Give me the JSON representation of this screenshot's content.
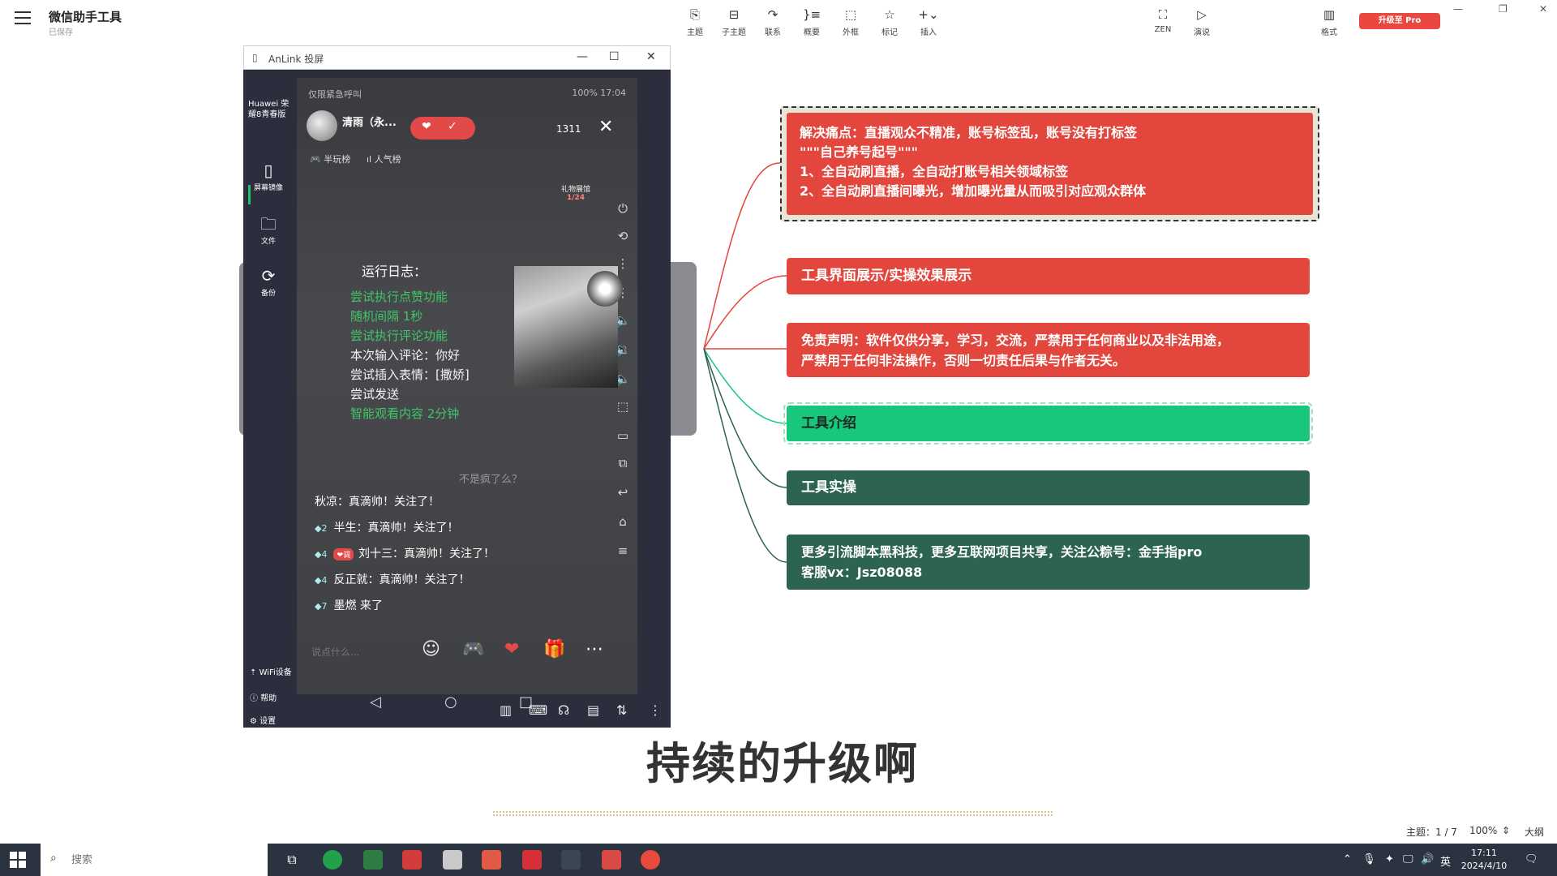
{
  "app": {
    "title": "微信助手工具",
    "subtitle": "已保存",
    "upgrade_label": "升级至 Pro"
  },
  "toolbar": [
    {
      "icon": "topic-icon",
      "glyph": "⎘",
      "label": "主题"
    },
    {
      "icon": "subtopic-icon",
      "glyph": "⊟",
      "label": "子主题"
    },
    {
      "icon": "relation-icon",
      "glyph": "↷",
      "label": "联系"
    },
    {
      "icon": "summary-icon",
      "glyph": "}≡",
      "label": "概要"
    },
    {
      "icon": "boundary-icon",
      "glyph": "⬚",
      "label": "外框"
    },
    {
      "icon": "marker-icon",
      "glyph": "☆",
      "label": "标记"
    },
    {
      "icon": "insert-icon",
      "glyph": "+⌄",
      "label": "插入"
    },
    {
      "icon": "zen-icon",
      "glyph": "⛶",
      "label": "ZEN"
    },
    {
      "icon": "present-icon",
      "glyph": "▷",
      "label": "演说"
    },
    {
      "icon": "format-icon",
      "glyph": "▥",
      "label": "格式"
    }
  ],
  "mirror": {
    "window_title": "AnLink 投屏",
    "device": "Huawei 荣耀8青春版",
    "sidebar": [
      {
        "icon": "phone-icon",
        "glyph": "▯",
        "label": "屏幕镜像"
      },
      {
        "icon": "folder-icon",
        "glyph": "🗀",
        "label": "文件"
      },
      {
        "icon": "backup-icon",
        "glyph": "⟳",
        "label": "备份"
      }
    ],
    "bottom": {
      "wifi": "WiFi设备",
      "help": "帮助",
      "settings": "设置"
    },
    "phone": {
      "status_left": "仅限紧急呼叫",
      "status_right": "100% 17:04",
      "streamer_name": "清雨（永...",
      "viewers": "1311",
      "rank_left": "半玩榜",
      "rank_right": "人气榜",
      "gift_title": "礼物展馆",
      "gift_count": "1/24",
      "log_title": "运行日志：",
      "log_lines": [
        {
          "text": "尝试执行点赞功能",
          "color": "green"
        },
        {
          "text": "随机间隔 1秒",
          "color": "green"
        },
        {
          "text": "尝试执行评论功能",
          "color": "green"
        },
        {
          "text": "本次输入评论：你好",
          "color": "white"
        },
        {
          "text": "尝试插入表情：[撒娇]",
          "color": "white"
        },
        {
          "text": "尝试发送",
          "color": "white"
        },
        {
          "text": "智能观看内容 2分钟",
          "color": "green"
        }
      ],
      "faded_comment": "不是疯了么？",
      "chat": [
        {
          "level": "",
          "badge": "",
          "text": "秋凉：真滴帅！关注了！"
        },
        {
          "level": "◆2",
          "badge": "",
          "text": "半生：真滴帅！关注了！"
        },
        {
          "level": "◆4",
          "badge": "❤调",
          "text": "刘十三：真滴帅！关注了！"
        },
        {
          "level": "◆4",
          "badge": "",
          "text": "反正就：真滴帅！关注了！"
        },
        {
          "level": "◆7",
          "badge": "",
          "text": "墨燃 来了"
        }
      ],
      "say_placeholder": "说点什么...",
      "input_icons": [
        {
          "name": "emoji-icon",
          "glyph": "☺"
        },
        {
          "name": "game-icon",
          "glyph": "🎮"
        },
        {
          "name": "heart-gift-icon",
          "glyph": "❤"
        },
        {
          "name": "gift-icon",
          "glyph": "🎁"
        },
        {
          "name": "more-icon",
          "glyph": "⋯"
        }
      ]
    }
  },
  "mindmap": {
    "nodes": [
      {
        "lines": [
          "解决痛点：直播观众不精准，账号标签乱，账号没有打标签",
          "\"\"\"自己养号起号\"\"\"",
          "1、全自动刷直播，全自动打账号相关领域标签",
          "2、全自动刷直播间曝光，增加曝光量从而吸引对应观众群体"
        ]
      },
      {
        "lines": [
          "工具界面展示/实操效果展示"
        ]
      },
      {
        "lines": [
          "免责声明：软件仅供分享，学习，交流，严禁用于任何商业以及非法用途，",
          "严禁用于任何非法操作，否则一切责任后果与作者无关。"
        ]
      },
      {
        "lines": [
          "工具介绍"
        ]
      },
      {
        "lines": [
          "工具实操"
        ]
      },
      {
        "lines": [
          "更多引流脚本黑科技，更多互联网项目共享，关注公粽号：金手指pro",
          "客服vx：Jsz08088"
        ]
      }
    ],
    "colors": {
      "red": "#e3463d",
      "green": "#19c77c",
      "dark_green": "#2d6352"
    }
  },
  "caption": "持续的升级啊",
  "statusbar": {
    "topic": "主题：1 / 7",
    "zoom": "100%",
    "outline": "大纲"
  },
  "taskbar": {
    "search_placeholder": "搜索",
    "ime": "英",
    "time": "17:11",
    "date": "2024/4/10"
  }
}
